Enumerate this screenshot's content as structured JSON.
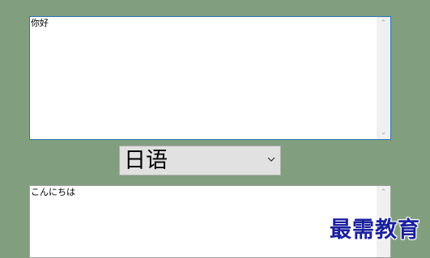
{
  "source": {
    "text": "你好"
  },
  "language_select": {
    "selected": "日语"
  },
  "target": {
    "text": "こんにちは"
  },
  "watermark": {
    "text": "最需教育"
  },
  "icons": {
    "scroll_up": "chevron-up-icon",
    "scroll_down": "chevron-down-icon",
    "dropdown": "chevron-down-icon"
  },
  "colors": {
    "background": "#819f7e",
    "focus_border": "#2e74b5",
    "watermark": "#1a1f9e"
  }
}
